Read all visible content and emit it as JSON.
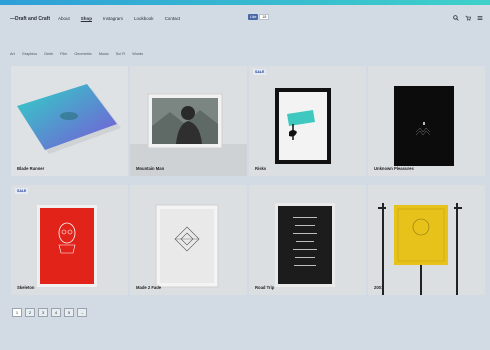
{
  "brand": "—Draft and Craft",
  "nav": [
    "About",
    "Shop",
    "Instagram",
    "Lookbook",
    "Contact"
  ],
  "fb": {
    "label": "Like",
    "count": "18"
  },
  "filters": [
    "Art",
    "Graphics",
    "Geek",
    "Film",
    "Geometric",
    "Music",
    "Sci Fi",
    "Words"
  ],
  "products": [
    {
      "name": "Blade Runner",
      "sale": ""
    },
    {
      "name": "Mountain Man",
      "sale": ""
    },
    {
      "name": "Risks",
      "sale": "SALE"
    },
    {
      "name": "Unknown Pleasures",
      "sale": ""
    },
    {
      "name": "Skeleton",
      "sale": "SALE"
    },
    {
      "name": "Made 2 Fade",
      "sale": ""
    },
    {
      "name": "Road Trip",
      "sale": ""
    },
    {
      "name": "2001",
      "sale": ""
    }
  ],
  "pager": [
    "1",
    "2",
    "3",
    "4",
    "5",
    "→"
  ],
  "colors": {
    "accent": "#2e9fd8",
    "sale": "#1f3b8f",
    "poster_red": "#e2231a",
    "poster_yellow": "#e6c21a"
  }
}
